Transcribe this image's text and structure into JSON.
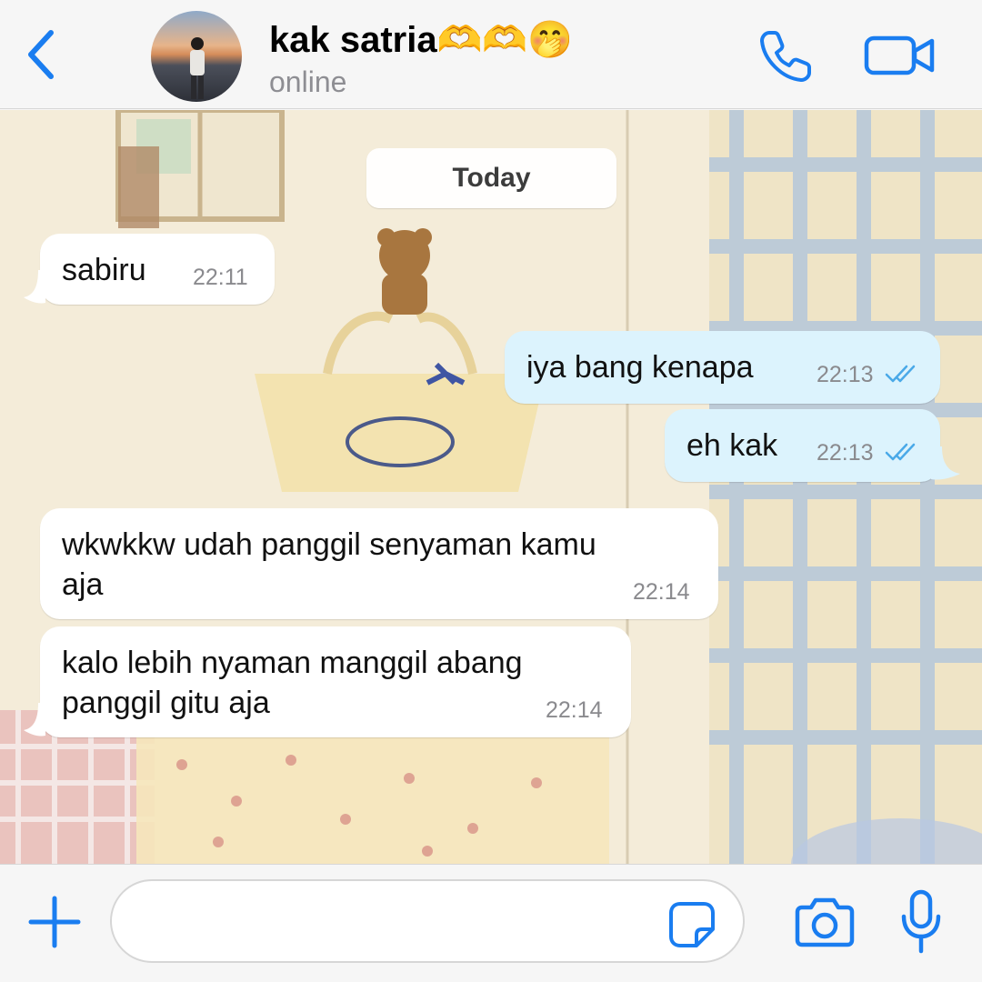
{
  "header": {
    "contact_name": "kak satria🫶🫶🤭",
    "status": "online",
    "back_icon": "chevron-left-icon",
    "call_icon": "phone-icon",
    "video_icon": "video-camera-icon"
  },
  "chat": {
    "date_label": "Today",
    "messages": [
      {
        "direction": "incoming",
        "lines": [
          "sabiru"
        ],
        "time": "22:11"
      },
      {
        "direction": "outgoing",
        "lines": [
          "iya bang kenapa"
        ],
        "time": "22:13",
        "status": "read"
      },
      {
        "direction": "outgoing",
        "lines": [
          "eh kak"
        ],
        "time": "22:13",
        "status": "read"
      },
      {
        "direction": "incoming",
        "lines": [
          "wkwkkw udah panggil senyaman kamu",
          "aja"
        ],
        "time": "22:14"
      },
      {
        "direction": "incoming",
        "lines": [
          "kalo lebih nyaman manggil abang",
          "panggil gitu aja"
        ],
        "time": "22:14"
      }
    ]
  },
  "input": {
    "value": "",
    "placeholder": "",
    "plus_icon": "plus-icon",
    "sticker_icon": "sticker-icon",
    "camera_icon": "camera-icon",
    "mic_icon": "microphone-icon"
  },
  "colors": {
    "accent": "#1a7df0",
    "incoming_bubble": "#ffffff",
    "outgoing_bubble": "#dcf3fd",
    "read_ticks": "#4aa9e8"
  }
}
